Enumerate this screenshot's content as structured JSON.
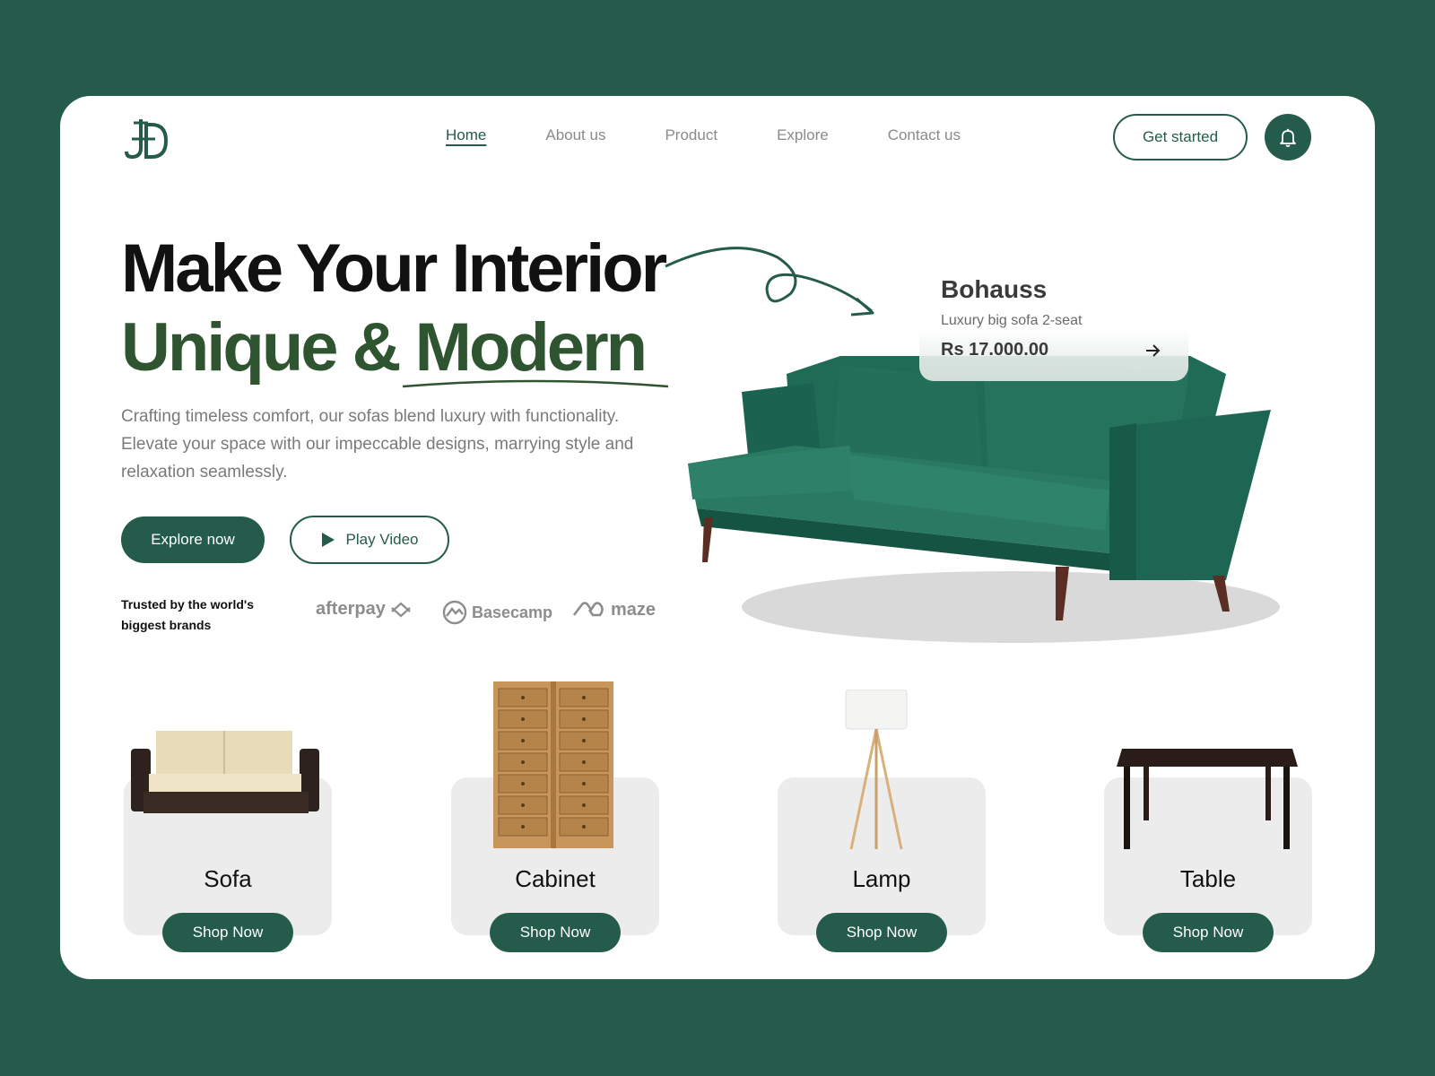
{
  "nav": {
    "items": [
      {
        "label": "Home",
        "active": true
      },
      {
        "label": "About us",
        "active": false
      },
      {
        "label": "Product",
        "active": false
      },
      {
        "label": "Explore",
        "active": false
      },
      {
        "label": "Contact us",
        "active": false
      }
    ],
    "cta_label": "Get started",
    "bell_icon": "bell-icon",
    "logo_icon": "jd-monogram-logo"
  },
  "hero": {
    "title_line1": "Make Your Interior",
    "title_line2": "Unique & Modern",
    "description": "Crafting timeless comfort, our sofas blend luxury with functionality. Elevate your space with our impeccable designs, marrying style and  relaxation seamlessly.",
    "explore_label": "Explore now",
    "play_label": "Play Video",
    "trusted_text": "Trusted by the world's biggest brands",
    "brands": [
      "afterpay",
      "Basecamp",
      "maze"
    ]
  },
  "featured": {
    "name": "Bohauss",
    "subtitle": "Luxury big sofa 2-seat",
    "price": "Rs 17.000.00"
  },
  "categories": [
    {
      "label": "Sofa",
      "button": "Shop Now"
    },
    {
      "label": "Cabinet",
      "button": "Shop Now"
    },
    {
      "label": "Lamp",
      "button": "Shop Now"
    },
    {
      "label": "Table",
      "button": "Shop Now"
    }
  ],
  "colors": {
    "brand_green": "#255b4b",
    "headline_green": "#2e5530",
    "background": "#255b4b"
  }
}
